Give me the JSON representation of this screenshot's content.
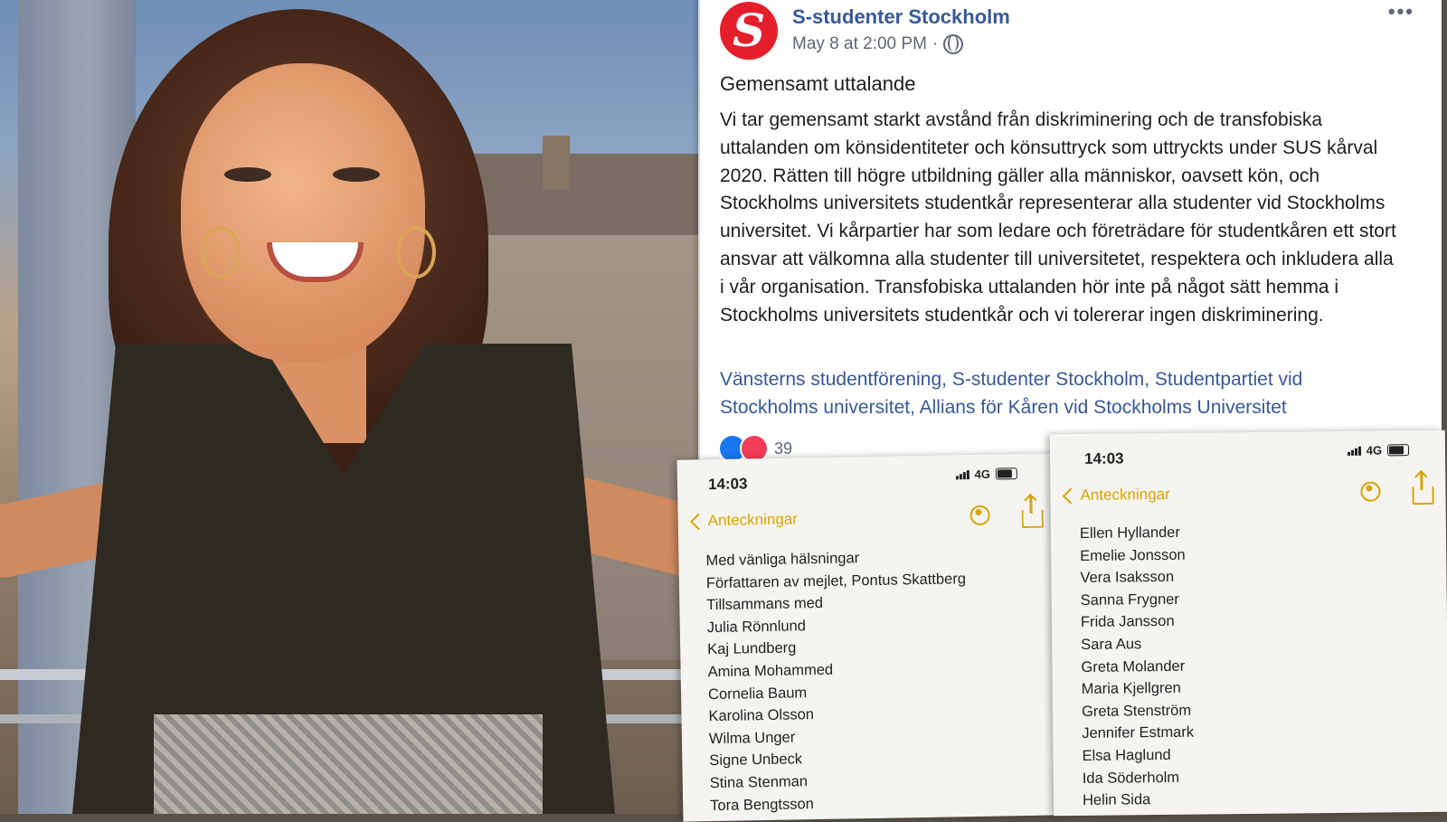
{
  "post": {
    "page_name": "S-studenter Stockholm",
    "timestamp": "May 8 at 2:00 PM",
    "separator": "·",
    "heading": "Gemensamt uttalande",
    "body": "Vi tar gemensamt starkt avstånd från diskriminering och de transfobiska uttalanden om könsidentiteter och könsuttryck som uttryckts under SUS kårval 2020. Rätten till högre utbildning gäller alla människor, oavsett kön, och Stockholms universitets studentkår representerar alla studenter vid Stockholms universitet. Vi kårpartier har som ledare och företrädare för studentkåren ett stort ansvar att välkomna alla studenter till universitetet, respektera och inkludera alla i vår organisation. Transfobiska uttalanden hör inte på något sätt hemma i Stockholms universitets studentkår och vi tolererar ingen diskriminering.",
    "tagged_pages": "Vänsterns studentförening, S-studenter Stockholm, Studentpartiet vid Stockholms universitet, Allians för Kåren vid Stockholms Universitet",
    "reaction_count": "39",
    "more_label": "•••"
  },
  "note_left": {
    "time": "14:03",
    "network": "4G",
    "back_label": "Anteckningar",
    "lines": [
      "Med vänliga hälsningar",
      "Författaren av mejlet, Pontus Skattberg",
      "Tillsammans med",
      "Julia Rönnlund",
      "Kaj Lundberg",
      "Amina Mohammed",
      "Cornelia Baum",
      "Karolina Olsson",
      "Wilma Unger",
      "Signe Unbeck",
      "Stina Stenman",
      "Tora Bengtsson"
    ]
  },
  "note_right": {
    "time": "14:03",
    "network": "4G",
    "back_label": "Anteckningar",
    "lines": [
      "Ellen Hyllander",
      "Emelie Jonsson",
      "Vera Isaksson",
      "Sanna Frygner",
      "Frida Jansson",
      "Sara Aus",
      "Greta Molander",
      "Maria Kjellgren",
      "Greta Stenström",
      "Jennifer Estmark",
      "Elsa Haglund",
      "Ida Söderholm",
      "Helin Sida"
    ]
  },
  "icons": {
    "avatar_letter": "S",
    "accent_color": "#d9a404",
    "facebook_link_color": "#385898",
    "brand_red": "#e41e2b"
  }
}
